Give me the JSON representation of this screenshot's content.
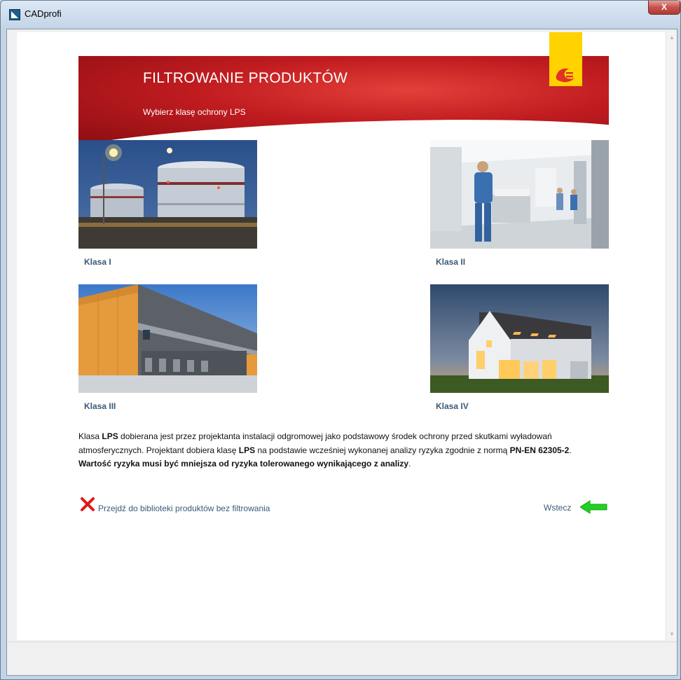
{
  "window": {
    "title": "CADprofi",
    "close_glyph": "X"
  },
  "banner": {
    "title": "FILTROWANIE PRODUKTÓW",
    "subtitle": "Wybierz klasę ochrony LPS",
    "logo_icon": "plug-logo-icon",
    "brand_color": "#c11c20",
    "logo_color": "#ffd200"
  },
  "tiles": [
    {
      "label": "Klasa I",
      "image": "industrial-tanks-image"
    },
    {
      "label": "Klasa II",
      "image": "hospital-corridor-image"
    },
    {
      "label": "Klasa III",
      "image": "warehouse-building-image"
    },
    {
      "label": "Klasa IV",
      "image": "house-dusk-image"
    }
  ],
  "description": {
    "p1_a": "Klasa ",
    "p1_b": "LPS",
    "p1_c": " dobierana jest przez projektanta instalacji odgromowej jako podstawowy środek ochrony przed skutkami wyładowań atmosferycznych. Projektant dobiera klasę ",
    "p1_d": "LPS",
    "p1_e": " na podstawie wcześniej wykonanej analizy ryzyka zgodnie z normą ",
    "p1_f": "PN-EN 62305-2",
    "p1_g": ".",
    "p2_bold": "Wartość ryzyka musi być mniejsza od ryzyka tolerowanego wynikającego z analizy",
    "p2_end": "."
  },
  "actions": {
    "skip_label": "Przejdź do biblioteki produktów bez filtrowania",
    "back_label": "Wstecz",
    "link_color": "#3a5a78"
  }
}
